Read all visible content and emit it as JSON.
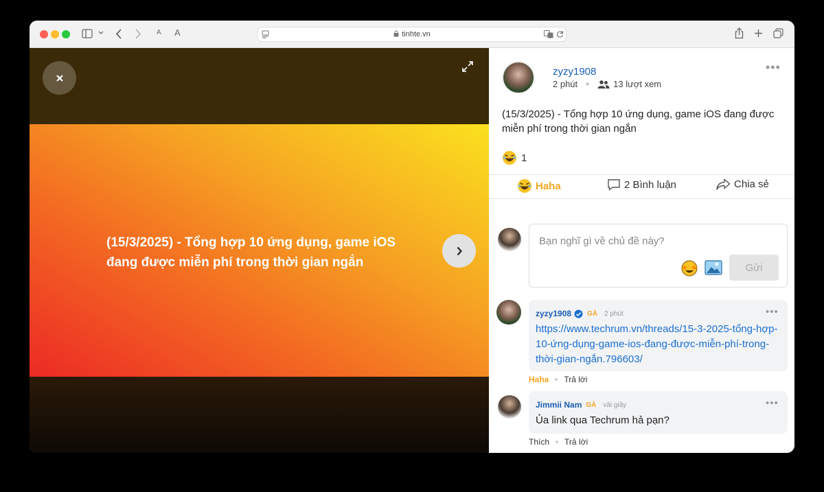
{
  "browser": {
    "url": "tinhte.vn",
    "text_size_small": "A",
    "text_size_large": "A"
  },
  "viewer": {
    "banner_text": "(15/3/2025) - Tổng hợp 10 ứng dụng, game iOS đang được miễn phí trong thời gian ngắn"
  },
  "post": {
    "author": "zyzy1908",
    "time": "2 phút",
    "views": "13 lượt xem",
    "title": "(15/3/2025) - Tổng hợp 10 ứng dụng, game iOS đang được miễn phí trong thời gian ngắn",
    "reaction_count": "1"
  },
  "actions": {
    "haha": "Haha",
    "comment": "2 Bình luận",
    "share": "Chia sẻ"
  },
  "compose": {
    "placeholder": "Bạn nghĩ gì về chủ đề này?",
    "send": "Gửi"
  },
  "comments": [
    {
      "author": "zyzy1908",
      "badge": "GÀ",
      "time": "2 phút",
      "text": "https://www.techrum.vn/threads/15-3-2025-tổng-hợp-10-ứng-dụng-game-ios-đang-được-miễn-phí-trong-thời-gian-ngắn.796603/",
      "react_label": "Haha",
      "reply_label": "Trả lời"
    },
    {
      "author": "Jimmii Nam",
      "badge": "GÀ",
      "time": "vài giây",
      "text": "Ủa link qua Techrum hả pạn?",
      "react_label": "Thích",
      "reply_label": "Trả lời"
    }
  ],
  "colors": {
    "accent_blue": "#1a5fb4",
    "haha_orange": "#f5a623",
    "link_blue": "#1a6fd1"
  }
}
